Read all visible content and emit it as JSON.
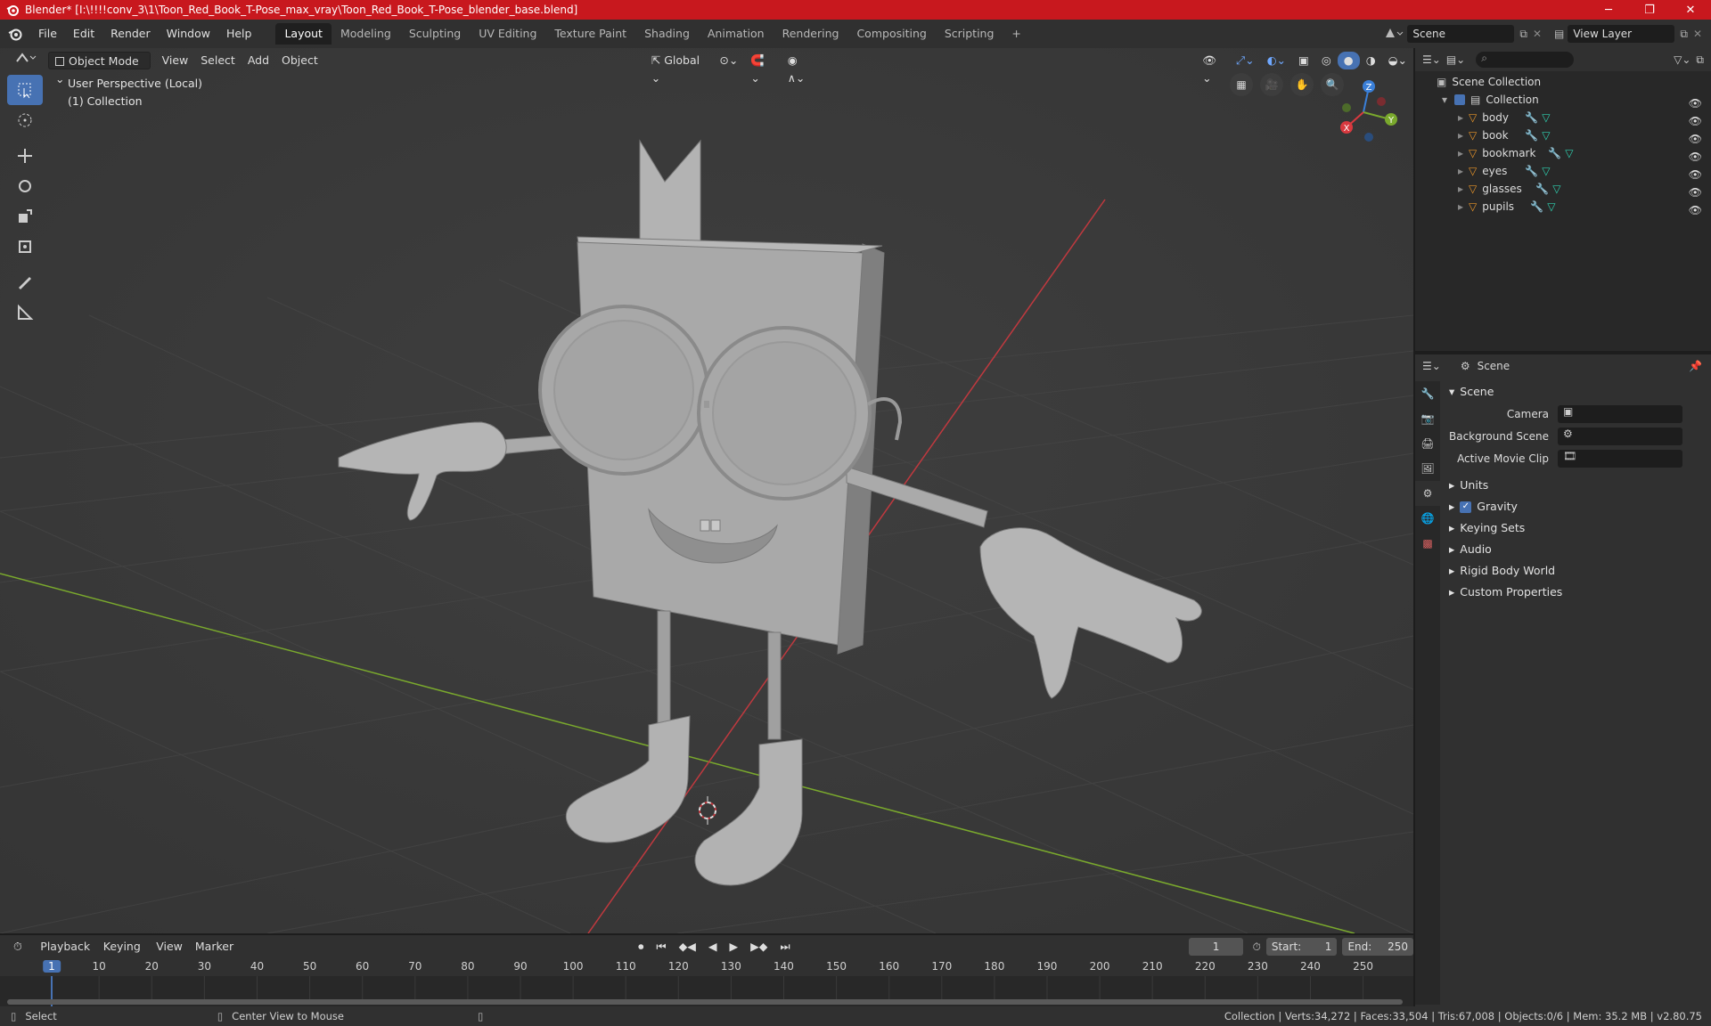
{
  "window": {
    "title": "Blender* [I:\\!!!!conv_3\\1\\Toon_Red_Book_T-Pose_max_vray\\Toon_Red_Book_T-Pose_blender_base.blend]",
    "minimize": "─",
    "maximize": "❐",
    "close": "✕"
  },
  "menus": [
    "File",
    "Edit",
    "Render",
    "Window",
    "Help"
  ],
  "workspaces": [
    "Layout",
    "Modeling",
    "Sculpting",
    "UV Editing",
    "Texture Paint",
    "Shading",
    "Animation",
    "Rendering",
    "Compositing",
    "Scripting"
  ],
  "topright": {
    "scene": "Scene",
    "view_layer": "View Layer"
  },
  "viewport": {
    "mode": "Object Mode",
    "menus": [
      "View",
      "Select",
      "Add",
      "Object"
    ],
    "transform_orientation": "Global",
    "info_line1": "User Perspective (Local)",
    "info_line2": "(1) Collection",
    "gizmo": {
      "x": "X",
      "y": "Y",
      "z": "Z"
    }
  },
  "outliner": {
    "root": "Scene Collection",
    "collection": "Collection",
    "items": [
      "body",
      "book",
      "bookmark",
      "eyes",
      "glasses",
      "pupils"
    ]
  },
  "properties": {
    "header": "Scene",
    "panel": "Scene",
    "camera_label": "Camera",
    "bg_scene_label": "Background Scene",
    "movie_clip_label": "Active Movie Clip",
    "subpanels": [
      "Units",
      "Gravity",
      "Keying Sets",
      "Audio",
      "Rigid Body World",
      "Custom Properties"
    ],
    "gravity_checked": true
  },
  "timeline": {
    "menus": [
      "Playback",
      "Keying",
      "View",
      "Marker"
    ],
    "current_frame": "1",
    "start_label": "Start:",
    "start": "1",
    "end_label": "End:",
    "end": "250",
    "ruler": [
      "1",
      "10",
      "20",
      "30",
      "40",
      "50",
      "60",
      "70",
      "80",
      "90",
      "100",
      "110",
      "120",
      "130",
      "140",
      "150",
      "160",
      "170",
      "180",
      "190",
      "200",
      "210",
      "220",
      "230",
      "240",
      "250"
    ]
  },
  "status": {
    "select": "Select",
    "center": "Center View to Mouse",
    "stats": "Collection | Verts:34,272 | Faces:33,504 | Tris:67,008 | Objects:0/6 | Mem: 35.2 MB | v2.80.75"
  },
  "colors": {
    "titlebar": "#c8181e",
    "active_blue": "#4772b3",
    "x_axis": "#d8393f",
    "y_axis": "#7aa92d",
    "z_axis": "#3a7fd8"
  }
}
